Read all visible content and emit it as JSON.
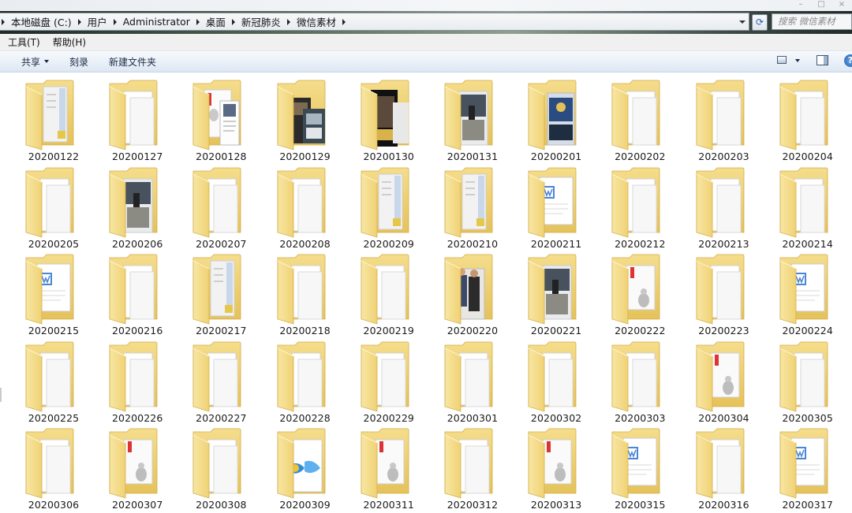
{
  "window": {
    "controls": [
      "–",
      "□",
      "×"
    ]
  },
  "address_bar": {
    "crumbs": [
      "本地磁盘 (C:)",
      "用户",
      "Administrator",
      "桌面",
      "新冠肺炎",
      "微信素材"
    ],
    "search_placeholder": "搜索 微信素材"
  },
  "menu": {
    "items": [
      "工具(T)",
      "帮助(H)"
    ]
  },
  "command_bar": {
    "share": "共享",
    "burn": "刻录",
    "new_folder": "新建文件夹"
  },
  "folders": [
    {
      "name": "20200122",
      "preview": "doc-blue"
    },
    {
      "name": "20200127",
      "preview": "plain"
    },
    {
      "name": "20200128",
      "preview": "photo-doc"
    },
    {
      "name": "20200129",
      "preview": "photo-dark"
    },
    {
      "name": "20200130",
      "preview": "photo-black"
    },
    {
      "name": "20200131",
      "preview": "photo-street"
    },
    {
      "name": "20200201",
      "preview": "photo-blue"
    },
    {
      "name": "20200202",
      "preview": "plain"
    },
    {
      "name": "20200203",
      "preview": "plain"
    },
    {
      "name": "20200204",
      "preview": "plain"
    },
    {
      "name": "20200205",
      "preview": "plain"
    },
    {
      "name": "20200206",
      "preview": "photo-street"
    },
    {
      "name": "20200207",
      "preview": "plain"
    },
    {
      "name": "20200208",
      "preview": "plain"
    },
    {
      "name": "20200209",
      "preview": "doc-blue"
    },
    {
      "name": "20200210",
      "preview": "doc-blue"
    },
    {
      "name": "20200211",
      "preview": "word"
    },
    {
      "name": "20200212",
      "preview": "plain"
    },
    {
      "name": "20200213",
      "preview": "plain"
    },
    {
      "name": "20200214",
      "preview": "plain"
    },
    {
      "name": "20200215",
      "preview": "word"
    },
    {
      "name": "20200216",
      "preview": "plain"
    },
    {
      "name": "20200217",
      "preview": "doc-blue"
    },
    {
      "name": "20200218",
      "preview": "plain"
    },
    {
      "name": "20200219",
      "preview": "plain"
    },
    {
      "name": "20200220",
      "preview": "photo-people"
    },
    {
      "name": "20200221",
      "preview": "photo-street"
    },
    {
      "name": "20200222",
      "preview": "red-doc"
    },
    {
      "name": "20200223",
      "preview": "plain"
    },
    {
      "name": "20200224",
      "preview": "word"
    },
    {
      "name": "20200225",
      "preview": "plain"
    },
    {
      "name": "20200226",
      "preview": "plain"
    },
    {
      "name": "20200227",
      "preview": "plain"
    },
    {
      "name": "20200228",
      "preview": "plain"
    },
    {
      "name": "20200229",
      "preview": "plain"
    },
    {
      "name": "20200301",
      "preview": "plain"
    },
    {
      "name": "20200302",
      "preview": "plain"
    },
    {
      "name": "20200303",
      "preview": "plain"
    },
    {
      "name": "20200304",
      "preview": "red-doc"
    },
    {
      "name": "20200305",
      "preview": "plain"
    },
    {
      "name": "20200306",
      "preview": "plain"
    },
    {
      "name": "20200307",
      "preview": "red-doc"
    },
    {
      "name": "20200308",
      "preview": "plain"
    },
    {
      "name": "20200309",
      "preview": "blue-art"
    },
    {
      "name": "20200311",
      "preview": "red-doc"
    },
    {
      "name": "20200312",
      "preview": "plain"
    },
    {
      "name": "20200313",
      "preview": "red-doc"
    },
    {
      "name": "20200315",
      "preview": "word"
    },
    {
      "name": "20200316",
      "preview": "plain"
    },
    {
      "name": "20200317",
      "preview": "word"
    }
  ]
}
